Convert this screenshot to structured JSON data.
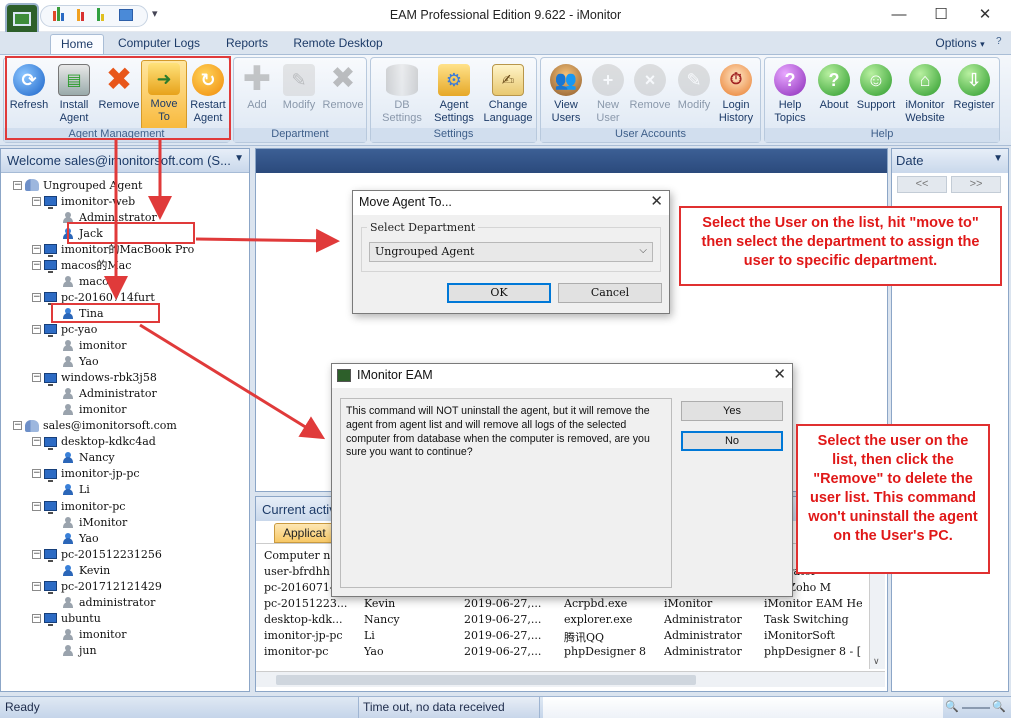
{
  "window": {
    "title": "EAM Professional Edition 9.622 - iMonitor",
    "controls": {
      "minimize": "—",
      "maximize": "☐",
      "close": "✕"
    },
    "quick_access_arrow": "▾"
  },
  "tabs": [
    {
      "label": "Home",
      "active": true
    },
    {
      "label": "Computer Logs",
      "active": false
    },
    {
      "label": "Reports",
      "active": false
    },
    {
      "label": "Remote Desktop",
      "active": false
    }
  ],
  "options_label": "Options",
  "ribbon": {
    "groups": [
      {
        "label": "Agent Management",
        "buttons": [
          {
            "line1": "Refresh",
            "line2": "",
            "icon": "refresh-icon",
            "enabled": true
          },
          {
            "line1": "Install",
            "line2": "Agent",
            "icon": "install-agent-icon",
            "enabled": true
          },
          {
            "line1": "Remove",
            "line2": "",
            "icon": "remove-x-icon",
            "enabled": true
          },
          {
            "line1": "Move",
            "line2": "To",
            "icon": "move-to-folder-icon",
            "enabled": true
          },
          {
            "line1": "Restart",
            "line2": "Agent",
            "icon": "restart-icon",
            "enabled": true
          }
        ]
      },
      {
        "label": "Department",
        "buttons": [
          {
            "line1": "Add",
            "line2": "",
            "icon": "add-plus-icon",
            "enabled": false
          },
          {
            "line1": "Modify",
            "line2": "",
            "icon": "modify-icon",
            "enabled": false
          },
          {
            "line1": "Remove",
            "line2": "",
            "icon": "remove-x-icon",
            "enabled": false
          }
        ]
      },
      {
        "label": "Settings",
        "buttons": [
          {
            "line1": "DB",
            "line2": "Settings",
            "icon": "database-icon",
            "enabled": false
          },
          {
            "line1": "Agent",
            "line2": "Settings",
            "icon": "agent-settings-icon",
            "enabled": true
          },
          {
            "line1": "Change",
            "line2": "Language",
            "icon": "language-icon",
            "enabled": true
          }
        ]
      },
      {
        "label": "User Accounts",
        "buttons": [
          {
            "line1": "View",
            "line2": "Users",
            "icon": "users-icon",
            "enabled": true
          },
          {
            "line1": "New",
            "line2": "User",
            "icon": "new-user-icon",
            "enabled": false
          },
          {
            "line1": "Remove",
            "line2": "",
            "icon": "remove-user-icon",
            "enabled": false
          },
          {
            "line1": "Modify",
            "line2": "",
            "icon": "modify-user-icon",
            "enabled": false
          },
          {
            "line1": "Login",
            "line2": "History",
            "icon": "login-history-icon",
            "enabled": true
          }
        ]
      },
      {
        "label": "Help",
        "buttons": [
          {
            "line1": "Help",
            "line2": "Topics",
            "icon": "help-icon",
            "enabled": true
          },
          {
            "line1": "About",
            "line2": "",
            "icon": "about-icon",
            "enabled": true
          },
          {
            "line1": "Support",
            "line2": "",
            "icon": "support-icon",
            "enabled": true
          },
          {
            "line1": "iMonitor",
            "line2": "Website",
            "icon": "home-icon",
            "enabled": true
          },
          {
            "line1": "Register",
            "line2": "",
            "icon": "register-icon",
            "enabled": true
          }
        ]
      }
    ]
  },
  "left_panel": {
    "header": "Welcome sales@imonitorsoft.com (S...",
    "tree": [
      {
        "label": "Ungrouped Agent",
        "kind": "group",
        "level": 0
      },
      {
        "label": "imonitor-web",
        "kind": "pc",
        "level": 1
      },
      {
        "label": "Administrator",
        "kind": "user-grey",
        "level": 2
      },
      {
        "label": "Jack",
        "kind": "user",
        "level": 2
      },
      {
        "label": "imonitor的MacBook Pro",
        "kind": "pc",
        "level": 1
      },
      {
        "label": "macos的Mac",
        "kind": "pc",
        "level": 1
      },
      {
        "label": "macos",
        "kind": "user-grey",
        "level": 2
      },
      {
        "label": "pc-20160714furt",
        "kind": "pc",
        "level": 1
      },
      {
        "label": "Tina",
        "kind": "user",
        "level": 2
      },
      {
        "label": "pc-yao",
        "kind": "pc",
        "level": 1
      },
      {
        "label": "imonitor",
        "kind": "user-grey",
        "level": 2
      },
      {
        "label": "Yao",
        "kind": "user-grey",
        "level": 2
      },
      {
        "label": "windows-rbk3j58",
        "kind": "pc",
        "level": 1
      },
      {
        "label": "Administrator",
        "kind": "user-grey",
        "level": 2
      },
      {
        "label": "imonitor",
        "kind": "user-grey",
        "level": 2
      },
      {
        "label": "sales@imonitorsoft.com",
        "kind": "group",
        "level": 0
      },
      {
        "label": "desktop-kdkc4ad",
        "kind": "pc",
        "level": 1
      },
      {
        "label": "Nancy",
        "kind": "user",
        "level": 2
      },
      {
        "label": "imonitor-jp-pc",
        "kind": "pc",
        "level": 1
      },
      {
        "label": "Li",
        "kind": "user",
        "level": 2
      },
      {
        "label": "imonitor-pc",
        "kind": "pc",
        "level": 1
      },
      {
        "label": "iMonitor",
        "kind": "user-grey",
        "level": 2
      },
      {
        "label": "Yao",
        "kind": "user",
        "level": 2
      },
      {
        "label": "pc-201512231256",
        "kind": "pc",
        "level": 1
      },
      {
        "label": "Kevin",
        "kind": "user",
        "level": 2
      },
      {
        "label": "pc-201712121429",
        "kind": "pc",
        "level": 1
      },
      {
        "label": "administrator",
        "kind": "user-grey",
        "level": 2
      },
      {
        "label": "ubuntu",
        "kind": "pc",
        "level": 1
      },
      {
        "label": "imonitor",
        "kind": "user-grey",
        "level": 2
      },
      {
        "label": "jun",
        "kind": "user-grey",
        "level": 2
      }
    ]
  },
  "activity_panel": {
    "header": "Current activ",
    "tab": "Applicat",
    "rows": [
      [
        "Computer na",
        "",
        "",
        "",
        "",
        ""
      ],
      [
        "user-bfrdhh",
        "",
        "",
        "",
        "",
        "inistrator"
      ],
      [
        "pc-20160714",
        "",
        "",
        "",
        "",
        "ail - Zoho M"
      ],
      [
        "pc-20151223...",
        "Kevin",
        "2019-06-27,...",
        "Acrpbd.exe",
        "iMonitor",
        "iMonitor EAM Help"
      ],
      [
        "desktop-kdk...",
        "Nancy",
        "2019-06-27,...",
        "explorer.exe",
        "Administrator",
        "Task Switching"
      ],
      [
        "imonitor-jp-pc",
        "Li",
        "2019-06-27,...",
        "腾讯QQ",
        "Administrator",
        "iMonitorSoft"
      ],
      [
        "imonitor-pc",
        "Yao",
        "2019-06-27,...",
        "phpDesigner 8",
        "Administrator",
        "phpDesigner 8 - ["
      ]
    ]
  },
  "right_panel": {
    "header": "Date",
    "prev": "<<",
    "next": ">>"
  },
  "status": {
    "left": "Ready",
    "middle": "Time out, no data received"
  },
  "move_dialog": {
    "title": "Move Agent To...",
    "group_label": "Select Department",
    "selected": "Ungrouped Agent",
    "ok": "OK",
    "cancel": "Cancel"
  },
  "confirm_dialog": {
    "title": "IMonitor EAM",
    "message": "This command will NOT uninstall the agent, but it will remove the agent from agent list and will remove all logs of the selected computer from database when the computer is removed, are you sure you want to continue?",
    "yes": "Yes",
    "no": "No"
  },
  "callouts": {
    "move": "Select the User on the list, hit \"move to\" then select the department to assign the user to specific department.",
    "remove": "Select the user on the list, then click the \"Remove\" to delete the user list. This command won't uninstall the agent on the User's PC."
  },
  "colors": {
    "annotation_red": "#e03030",
    "ribbon_blue": "#dce6f2",
    "header_dark": "#2b4a7c"
  }
}
